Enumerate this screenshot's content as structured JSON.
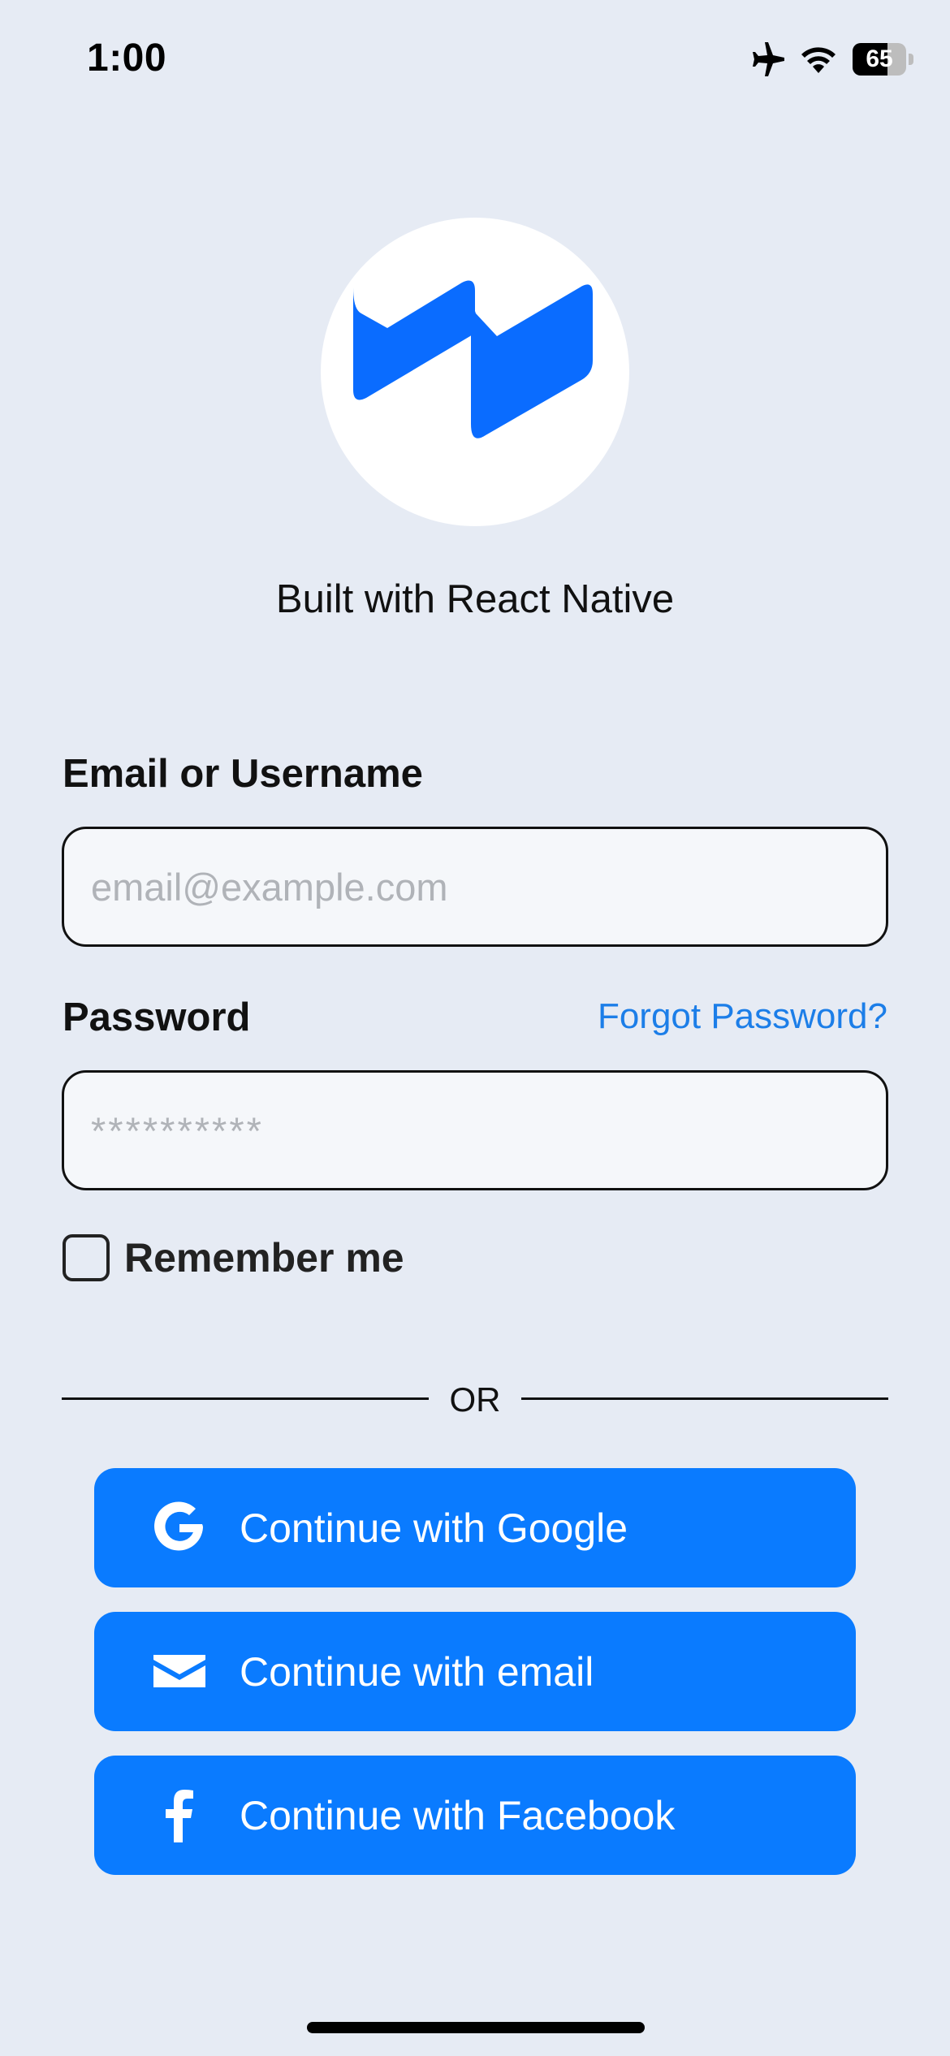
{
  "status_bar": {
    "time": "1:00",
    "battery": "65",
    "battery_level": 0.65,
    "icons": [
      "airplane-icon",
      "wifi-icon",
      "battery-icon"
    ]
  },
  "logo": {
    "icon": "react-native-logo",
    "tagline": "Built with React Native"
  },
  "form": {
    "email_label": "Email or Username",
    "email_placeholder": "email@example.com",
    "password_label": "Password",
    "forgot_password": "Forgot Password?",
    "password_placeholder": "**********",
    "remember_me": "Remember me",
    "remember_checked": false
  },
  "divider_text": "OR",
  "social_buttons": [
    {
      "label": "Continue with Google",
      "icon": "google-icon"
    },
    {
      "label": "Continue with email",
      "icon": "mail-icon"
    },
    {
      "label": "Continue with Facebook",
      "icon": "facebook-icon"
    }
  ],
  "colors": {
    "background": "#e6ebf4",
    "accent": "#0a7bff",
    "link": "#1c7ee8",
    "logo_blue": "#0a6cff"
  }
}
